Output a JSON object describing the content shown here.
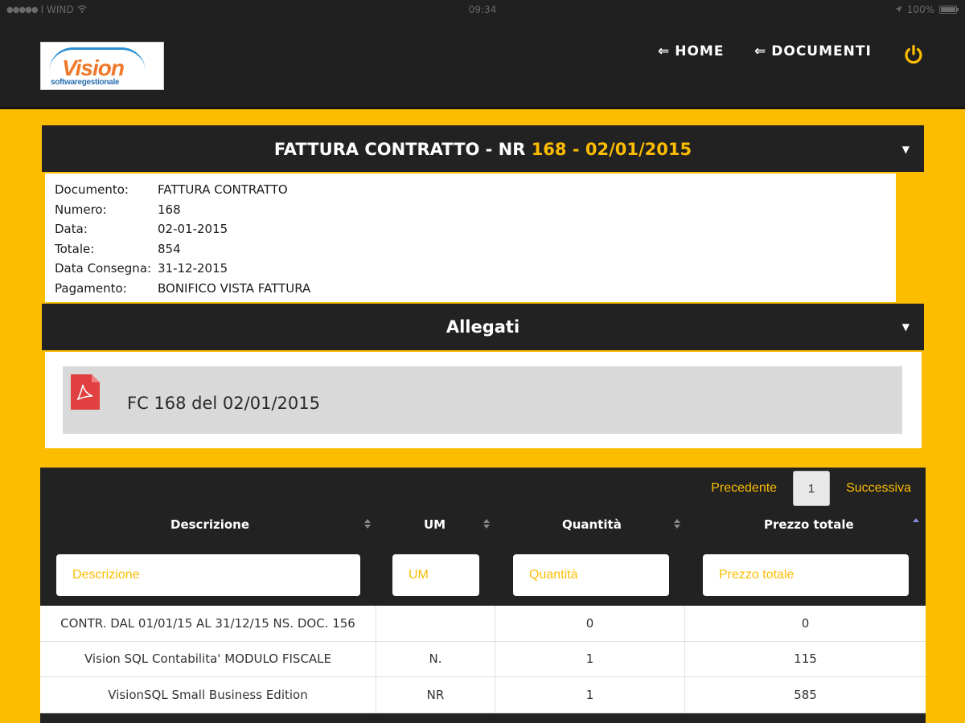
{
  "status_bar": {
    "carrier": "I WIND",
    "time": "09:34",
    "battery": "100%",
    "battery_level": 1.0
  },
  "header": {
    "logo": {
      "main": "Vision",
      "sub": "softwaregestionale"
    },
    "nav_home": "HOME",
    "nav_documents": "DOCUMENTI",
    "power_icon": "power-icon",
    "accent_color": "#fcbd00"
  },
  "document": {
    "title_prefix": "FATTURA CONTRATTO - NR ",
    "title_highlight": "168 - 02/01/2015",
    "details": [
      {
        "label": "Documento:",
        "value": "FATTURA CONTRATTO"
      },
      {
        "label": "Numero:",
        "value": "168"
      },
      {
        "label": "Data:",
        "value": "02-01-2015"
      },
      {
        "label": "Totale:",
        "value": "854"
      },
      {
        "label": "Data Consegna:",
        "value": "31-12-2015"
      },
      {
        "label": "Pagamento:",
        "value": "BONIFICO VISTA FATTURA"
      }
    ]
  },
  "attachments": {
    "title": "Allegati",
    "items": [
      {
        "label": "FC 168 del 02/01/2015",
        "icon": "pdf-icon"
      }
    ]
  },
  "table": {
    "pagination": {
      "prev": "Precedente",
      "page": "1",
      "next": "Successiva"
    },
    "columns": [
      "Descrizione",
      "UM",
      "Quantità",
      "Prezzo totale"
    ],
    "filters": [
      "Descrizione",
      "UM",
      "Quantità",
      "Prezzo totale"
    ],
    "rows": [
      [
        "CONTR. DAL 01/01/15 AL 31/12/15 NS. DOC. 156",
        "",
        "0",
        "0"
      ],
      [
        "Vision SQL Contabilita' MODULO FISCALE",
        "N.",
        "1",
        "115"
      ],
      [
        "VisionSQL Small Business Edition",
        "NR",
        "1",
        "585"
      ]
    ]
  }
}
